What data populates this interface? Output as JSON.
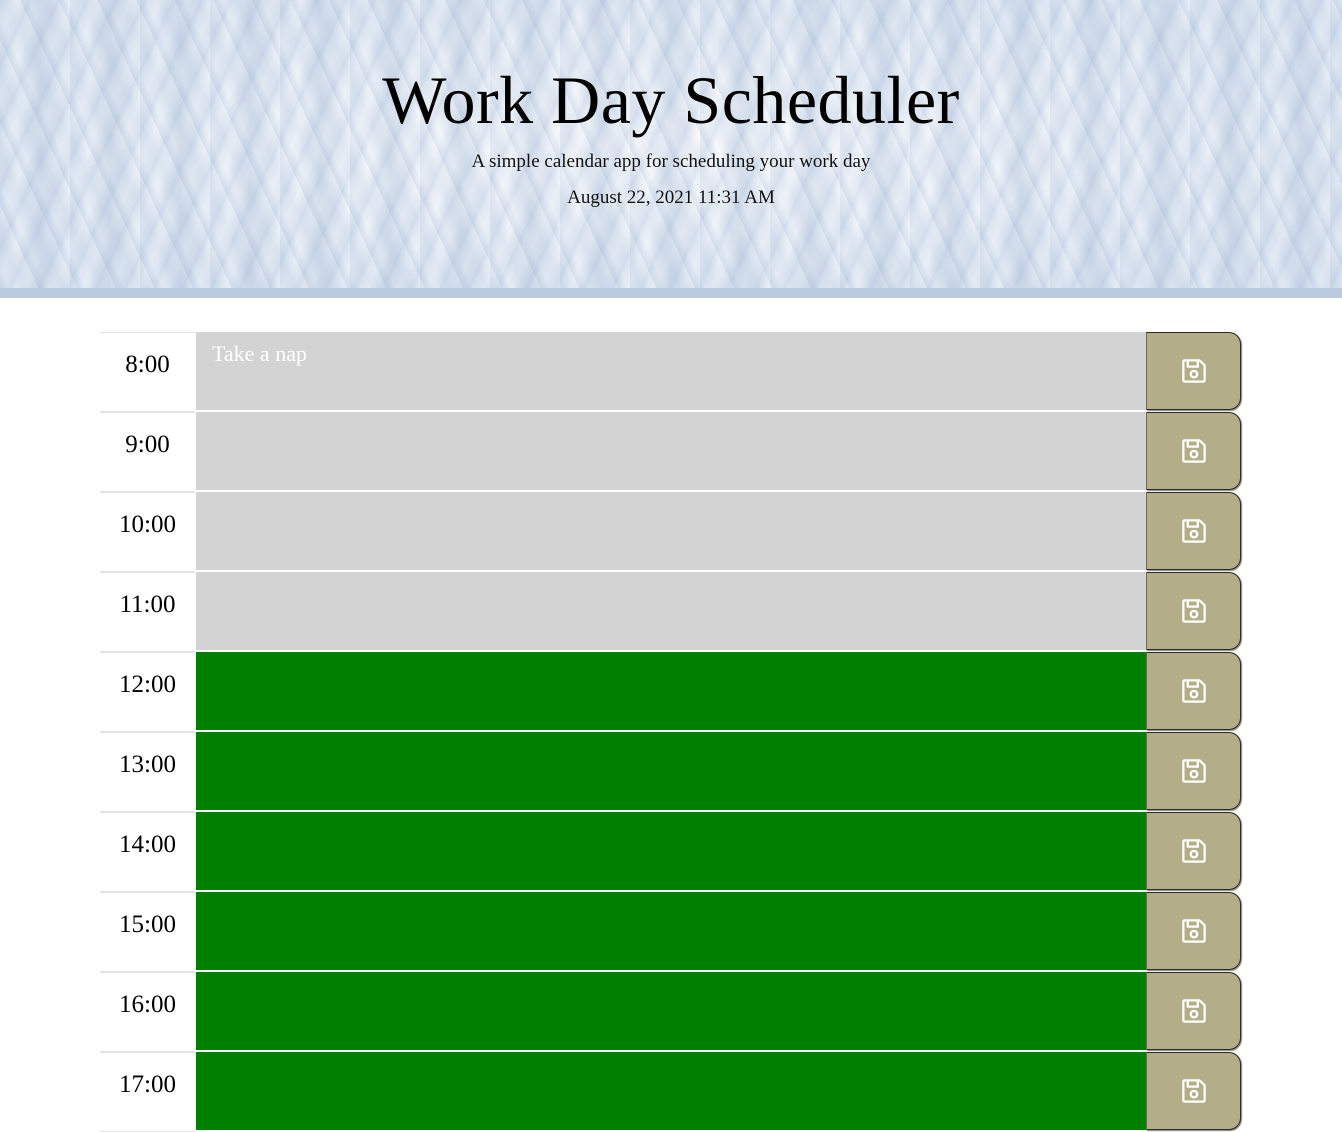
{
  "header": {
    "title": "Work Day Scheduler",
    "subtitle": "A simple calendar app for scheduling your work day",
    "current_date": "August 22, 2021 11:31 AM"
  },
  "colors": {
    "past": "#d3d3d3",
    "future": "#008000",
    "save_button": "#b3ad88"
  },
  "rows": [
    {
      "hour": "8:00",
      "text": "Take a nap",
      "state": "past",
      "save_icon": "floppy-disk-icon"
    },
    {
      "hour": "9:00",
      "text": "",
      "state": "past",
      "save_icon": "floppy-disk-icon"
    },
    {
      "hour": "10:00",
      "text": "",
      "state": "past",
      "save_icon": "floppy-disk-icon"
    },
    {
      "hour": "11:00",
      "text": "",
      "state": "past",
      "save_icon": "floppy-disk-icon"
    },
    {
      "hour": "12:00",
      "text": "",
      "state": "future",
      "save_icon": "floppy-disk-icon"
    },
    {
      "hour": "13:00",
      "text": "",
      "state": "future",
      "save_icon": "floppy-disk-icon"
    },
    {
      "hour": "14:00",
      "text": "",
      "state": "future",
      "save_icon": "floppy-disk-icon"
    },
    {
      "hour": "15:00",
      "text": "",
      "state": "future",
      "save_icon": "floppy-disk-icon"
    },
    {
      "hour": "16:00",
      "text": "",
      "state": "future",
      "save_icon": "floppy-disk-icon"
    },
    {
      "hour": "17:00",
      "text": "",
      "state": "future",
      "save_icon": "floppy-disk-icon"
    }
  ]
}
